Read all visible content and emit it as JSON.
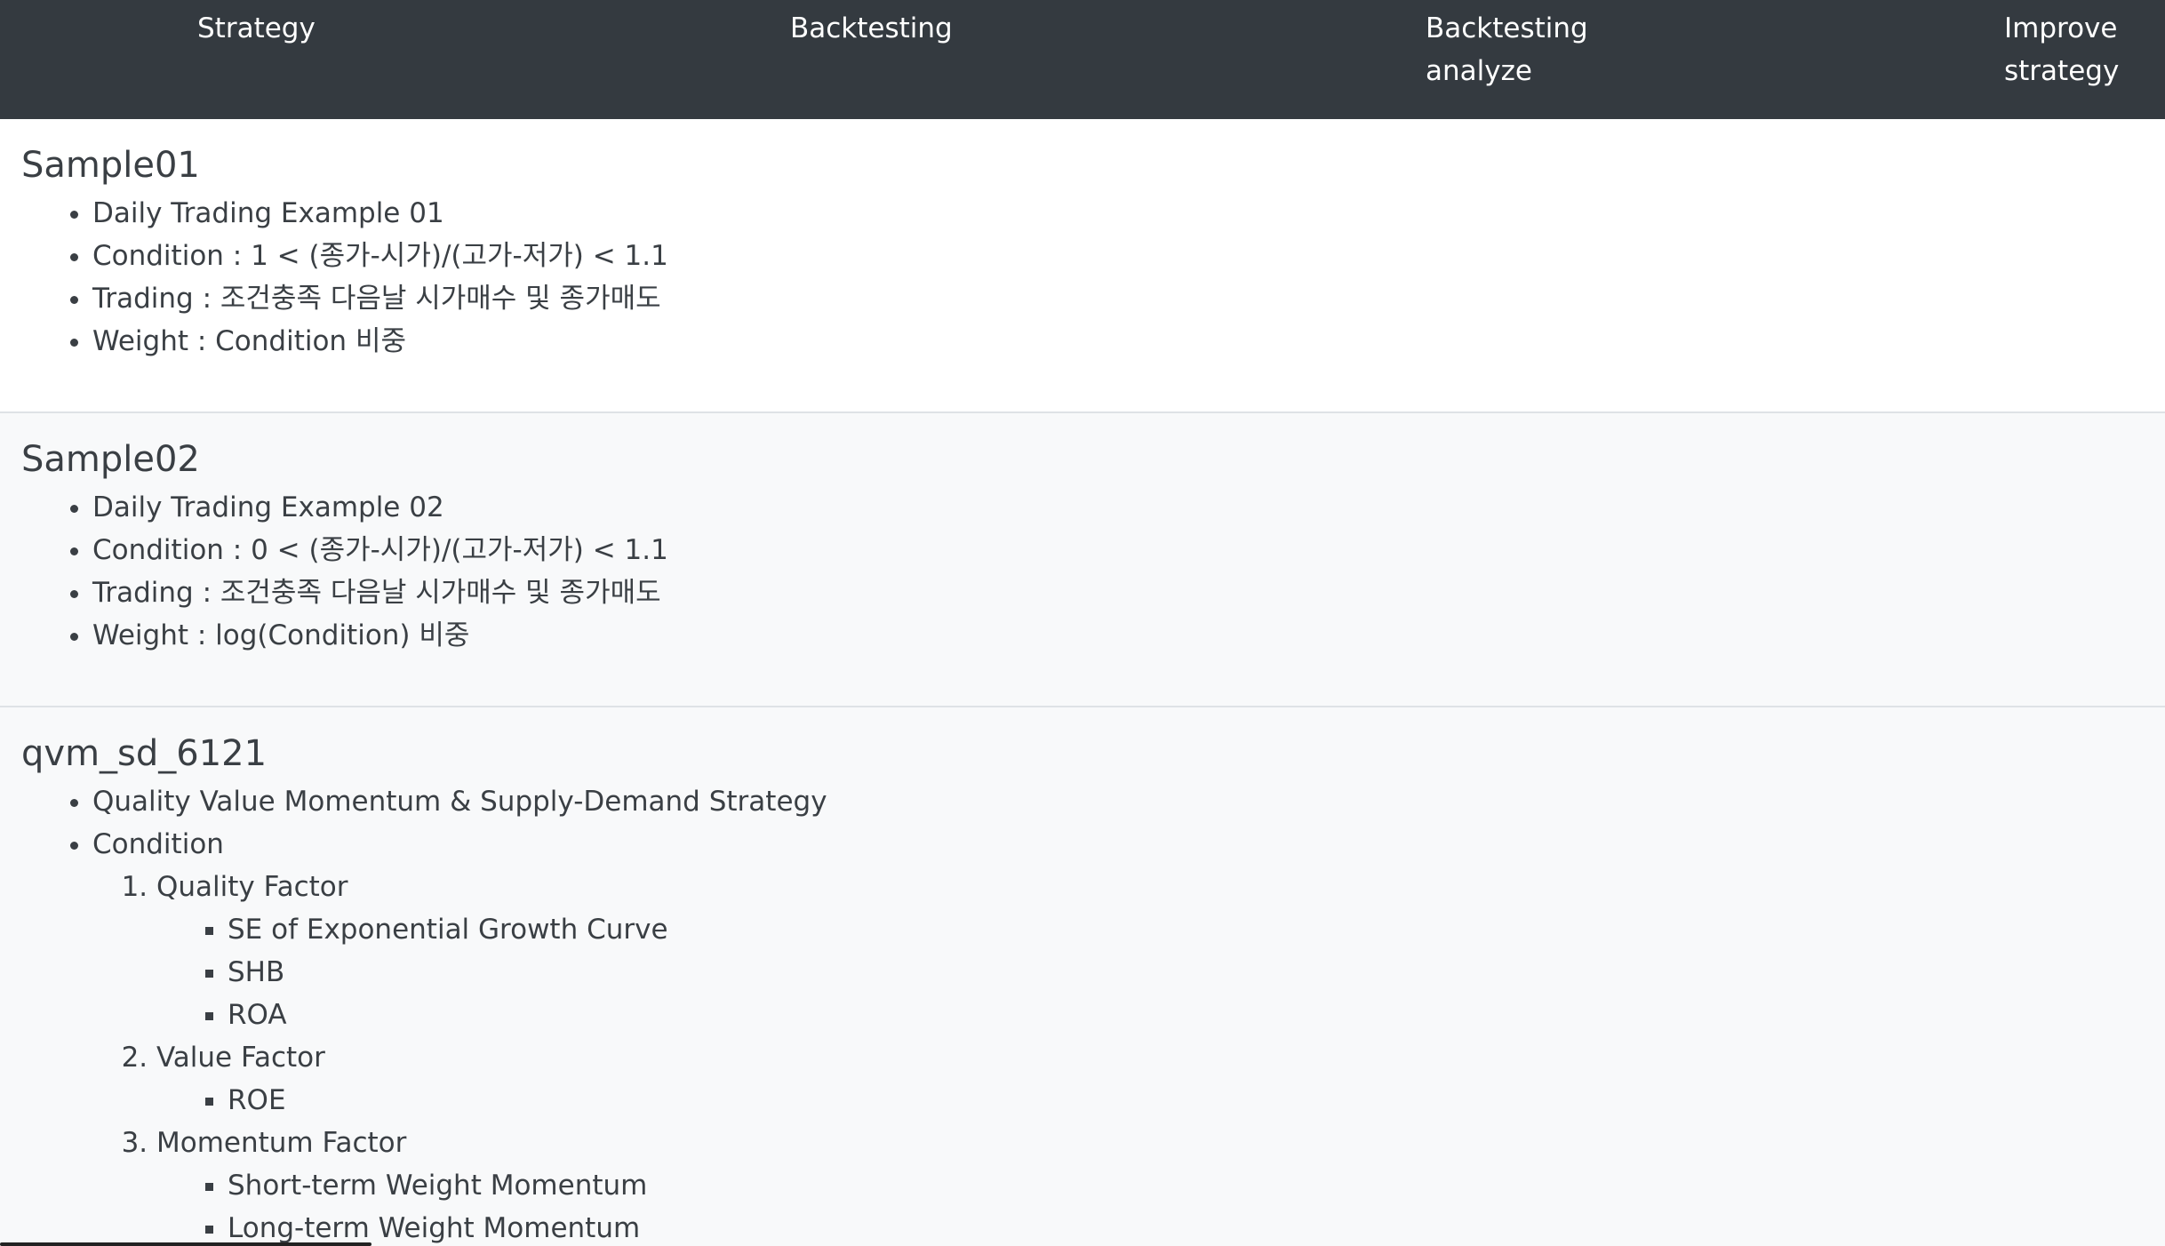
{
  "nav": {
    "items": [
      {
        "line1": "Strategy",
        "line2": ""
      },
      {
        "line1": "Backtesting",
        "line2": ""
      },
      {
        "line1": "Backtesting",
        "line2": "analyze"
      },
      {
        "line1": "Improve",
        "line2": "strategy"
      }
    ]
  },
  "sections": [
    {
      "title": "Sample01",
      "items": [
        "Daily Trading Example 01",
        "Condition : 1 < (종가-시가)/(고가-저가) < 1.1",
        "Trading : 조건충족 다음날 시가매수 및 종가매도",
        "Weight : Condition 비중"
      ]
    },
    {
      "title": "Sample02",
      "items": [
        "Daily Trading Example 02",
        "Condition : 0 < (종가-시가)/(고가-저가) < 1.1",
        "Trading : 조건충족 다음날 시가매수 및 종가매도",
        "Weight : log(Condition) 비중"
      ]
    },
    {
      "title": "qvm_sd_6121",
      "description": "Quality Value Momentum & Supply-Demand Strategy",
      "condition_label": "Condition",
      "factors": [
        {
          "name": "Quality Factor",
          "subitems": [
            "SE of Exponential Growth Curve",
            "SHB",
            "ROA"
          ]
        },
        {
          "name": "Value Factor",
          "subitems": [
            "ROE"
          ]
        },
        {
          "name": "Momentum Factor",
          "subitems": [
            "Short-term Weight Momentum",
            "Long-term Weight Momentum"
          ]
        }
      ]
    }
  ]
}
